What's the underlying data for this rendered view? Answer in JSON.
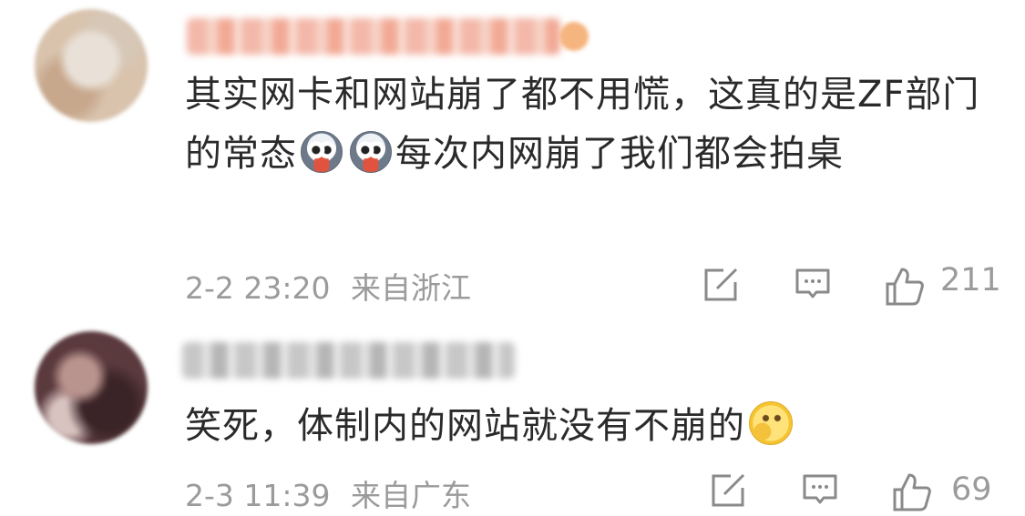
{
  "comments": [
    {
      "text_before": "其实网卡和网站崩了都不用慌，这真的是ZF部门的常态",
      "emojis": [
        "dog-emoji",
        "dog-emoji"
      ],
      "text_after": "每次内网崩了我们都会拍桌",
      "date": "2-2 23:20",
      "location": "来自浙江",
      "likes": "211"
    },
    {
      "text_before": "笑死，体制内的网站就没有不崩的",
      "emojis": [
        "thinking-emoji"
      ],
      "text_after": "",
      "date": "2-3 11:39",
      "location": "来自广东",
      "likes": "69"
    }
  ]
}
